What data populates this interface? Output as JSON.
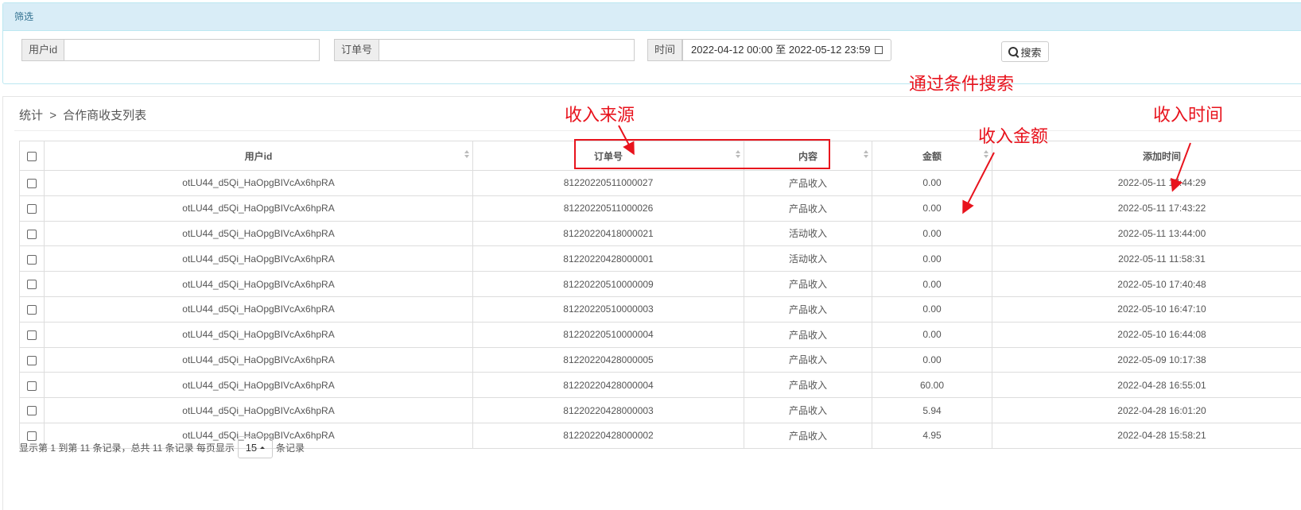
{
  "filter": {
    "title": "筛选",
    "user_id_label": "用户id",
    "user_id_value": "",
    "order_no_label": "订单号",
    "order_no_value": "",
    "time_label": "时间",
    "time_value": "2022-04-12 00:00 至 2022-05-12 23:59",
    "search_label": "搜索"
  },
  "breadcrumb": {
    "root": "统计",
    "sep": ">",
    "current": "合作商收支列表"
  },
  "table": {
    "columns": [
      "用户id",
      "订单号",
      "内容",
      "金额",
      "添加时间"
    ],
    "rows": [
      {
        "user_id": "otLU44_d5Qi_HaOpgBIVcAx6hpRA",
        "order_no": "81220220511000027",
        "content": "产品收入",
        "amount": "0.00",
        "time": "2022-05-11 17:44:29"
      },
      {
        "user_id": "otLU44_d5Qi_HaOpgBIVcAx6hpRA",
        "order_no": "81220220511000026",
        "content": "产品收入",
        "amount": "0.00",
        "time": "2022-05-11 17:43:22"
      },
      {
        "user_id": "otLU44_d5Qi_HaOpgBIVcAx6hpRA",
        "order_no": "81220220418000021",
        "content": "活动收入",
        "amount": "0.00",
        "time": "2022-05-11 13:44:00"
      },
      {
        "user_id": "otLU44_d5Qi_HaOpgBIVcAx6hpRA",
        "order_no": "81220220428000001",
        "content": "活动收入",
        "amount": "0.00",
        "time": "2022-05-11 11:58:31"
      },
      {
        "user_id": "otLU44_d5Qi_HaOpgBIVcAx6hpRA",
        "order_no": "81220220510000009",
        "content": "产品收入",
        "amount": "0.00",
        "time": "2022-05-10 17:40:48"
      },
      {
        "user_id": "otLU44_d5Qi_HaOpgBIVcAx6hpRA",
        "order_no": "81220220510000003",
        "content": "产品收入",
        "amount": "0.00",
        "time": "2022-05-10 16:47:10"
      },
      {
        "user_id": "otLU44_d5Qi_HaOpgBIVcAx6hpRA",
        "order_no": "81220220510000004",
        "content": "产品收入",
        "amount": "0.00",
        "time": "2022-05-10 16:44:08"
      },
      {
        "user_id": "otLU44_d5Qi_HaOpgBIVcAx6hpRA",
        "order_no": "81220220428000005",
        "content": "产品收入",
        "amount": "0.00",
        "time": "2022-05-09 10:17:38"
      },
      {
        "user_id": "otLU44_d5Qi_HaOpgBIVcAx6hpRA",
        "order_no": "81220220428000004",
        "content": "产品收入",
        "amount": "60.00",
        "time": "2022-04-28 16:55:01"
      },
      {
        "user_id": "otLU44_d5Qi_HaOpgBIVcAx6hpRA",
        "order_no": "81220220428000003",
        "content": "产品收入",
        "amount": "5.94",
        "time": "2022-04-28 16:01:20"
      },
      {
        "user_id": "otLU44_d5Qi_HaOpgBIVcAx6hpRA",
        "order_no": "81220220428000002",
        "content": "产品收入",
        "amount": "4.95",
        "time": "2022-04-28 15:58:21"
      }
    ]
  },
  "footer": {
    "summary": "显示第 1 到第 11 条记录，总共 11 条记录 每页显示",
    "page_size": "15",
    "suffix": "条记录"
  },
  "annotations": {
    "search": "通过条件搜索",
    "source": "收入来源",
    "amount": "收入金额",
    "time": "收入时间",
    "color": "#e8131d"
  }
}
